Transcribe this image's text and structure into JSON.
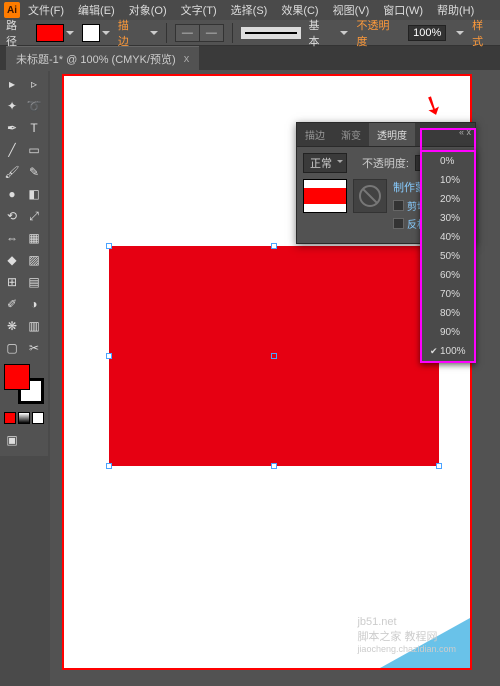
{
  "menubar": {
    "items": [
      "文件(F)",
      "编辑(E)",
      "对象(O)",
      "文字(T)",
      "选择(S)",
      "效果(C)",
      "视图(V)",
      "窗口(W)",
      "帮助(H)"
    ]
  },
  "controlbar": {
    "label": "路径",
    "stroke_label": "描边",
    "style_label": "基本",
    "opacity_label": "不透明度",
    "opacity_value": "100%",
    "styles_label": "样式"
  },
  "doctab": {
    "title": "未标题-1* @ 100% (CMYK/预览)",
    "close": "x"
  },
  "panel": {
    "tabs": [
      "描边",
      "渐变",
      "透明度"
    ],
    "active_tab": 2,
    "blend_mode": "正常",
    "opacity_label": "不透明度:",
    "opacity_value": "100%",
    "make_mask": "制作蒙版",
    "clip": "剪切",
    "invert": "反相蒙版",
    "close": "« x"
  },
  "opacity_menu": {
    "items": [
      "0%",
      "10%",
      "20%",
      "30%",
      "40%",
      "50%",
      "60%",
      "70%",
      "80%",
      "90%",
      "100%"
    ],
    "checked": 10
  },
  "watermark": {
    "line1": "jb51.net",
    "line2": "脚本之家 教程网",
    "line3": "jiaocheng.chazidian.com"
  }
}
